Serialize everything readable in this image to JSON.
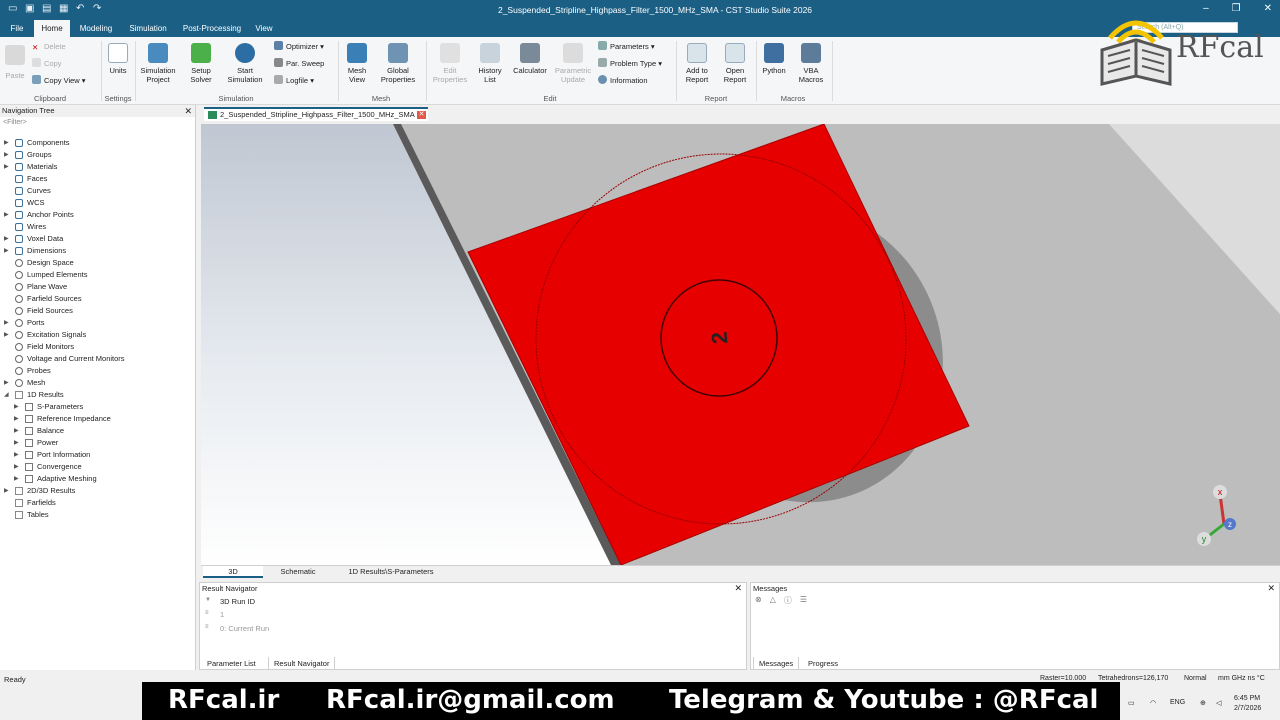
{
  "window": {
    "title": "2_Suspended_Stripline_Highpass_Filter_1500_MHz_SMA - CST Studio Suite 2026",
    "search_placeholder": "Search (Alt+Q)"
  },
  "menu": {
    "tabs": [
      "File",
      "Home",
      "Modeling",
      "Simulation",
      "Post-Processing",
      "View"
    ],
    "active": "Home"
  },
  "ribbon": {
    "clipboard": {
      "paste": "Paste",
      "delete": "Delete",
      "copy": "Copy",
      "copy_view": "Copy View",
      "group": "Clipboard"
    },
    "settings": {
      "units": "Units",
      "group": "Settings"
    },
    "simulation": {
      "sim_project": "Simulation Project",
      "setup_solver": "Setup Solver",
      "start_sim": "Start Simulation",
      "optimizer": "Optimizer",
      "par_sweep": "Par. Sweep",
      "logfile": "Logfile",
      "group": "Simulation"
    },
    "mesh": {
      "mesh_view": "Mesh View",
      "global_props": "Global Properties",
      "group": "Mesh"
    },
    "edit": {
      "edit_props": "Edit Properties",
      "history": "History List",
      "calculator": "Calculator",
      "param_update": "Parametric Update",
      "parameters": "Parameters",
      "problem_type": "Problem Type",
      "information": "Information",
      "group": "Edit"
    },
    "report": {
      "add": "Add to Report",
      "open": "Open Report",
      "group": "Report"
    },
    "macros": {
      "python": "Python",
      "vba": "VBA Macros",
      "group": "Macros"
    }
  },
  "nav": {
    "title": "Navigation Tree",
    "filter": "<Filter>",
    "items": [
      {
        "label": "Components",
        "level": 0,
        "icon": "component-icon",
        "expand": "closed"
      },
      {
        "label": "Groups",
        "level": 0,
        "icon": "component-icon",
        "expand": "closed"
      },
      {
        "label": "Materials",
        "level": 0,
        "icon": "component-icon",
        "expand": "closed"
      },
      {
        "label": "Faces",
        "level": 0,
        "icon": "component-icon",
        "expand": "none"
      },
      {
        "label": "Curves",
        "level": 0,
        "icon": "component-icon",
        "expand": "none"
      },
      {
        "label": "WCS",
        "level": 0,
        "icon": "component-icon",
        "expand": "none"
      },
      {
        "label": "Anchor Points",
        "level": 0,
        "icon": "component-icon",
        "expand": "closed"
      },
      {
        "label": "Wires",
        "level": 0,
        "icon": "component-icon",
        "expand": "none"
      },
      {
        "label": "Voxel Data",
        "level": 0,
        "icon": "component-icon",
        "expand": "closed"
      },
      {
        "label": "Dimensions",
        "level": 0,
        "icon": "component-icon",
        "expand": "closed"
      },
      {
        "label": "Design Space",
        "level": 0,
        "icon": "gear-icon",
        "expand": "none"
      },
      {
        "label": "Lumped Elements",
        "level": 0,
        "icon": "gear-icon",
        "expand": "none"
      },
      {
        "label": "Plane Wave",
        "level": 0,
        "icon": "gear-icon",
        "expand": "none"
      },
      {
        "label": "Farfield Sources",
        "level": 0,
        "icon": "gear-icon",
        "expand": "none"
      },
      {
        "label": "Field Sources",
        "level": 0,
        "icon": "gear-icon",
        "expand": "none"
      },
      {
        "label": "Ports",
        "level": 0,
        "icon": "gear-icon",
        "expand": "closed"
      },
      {
        "label": "Excitation Signals",
        "level": 0,
        "icon": "gear-icon",
        "expand": "closed"
      },
      {
        "label": "Field Monitors",
        "level": 0,
        "icon": "gear-icon",
        "expand": "none"
      },
      {
        "label": "Voltage and Current Monitors",
        "level": 0,
        "icon": "gear-icon",
        "expand": "none"
      },
      {
        "label": "Probes",
        "level": 0,
        "icon": "gear-icon",
        "expand": "none"
      },
      {
        "label": "Mesh",
        "level": 0,
        "icon": "gear-icon",
        "expand": "closed"
      },
      {
        "label": "1D Results",
        "level": 0,
        "icon": "result-icon",
        "expand": "open"
      },
      {
        "label": "S-Parameters",
        "level": 1,
        "icon": "folder-icon",
        "expand": "closed"
      },
      {
        "label": "Reference Impedance",
        "level": 1,
        "icon": "folder-icon",
        "expand": "closed"
      },
      {
        "label": "Balance",
        "level": 1,
        "icon": "folder-icon",
        "expand": "closed"
      },
      {
        "label": "Power",
        "level": 1,
        "icon": "folder-icon",
        "expand": "closed"
      },
      {
        "label": "Port Information",
        "level": 1,
        "icon": "folder-icon",
        "expand": "closed"
      },
      {
        "label": "Convergence",
        "level": 1,
        "icon": "folder-icon",
        "expand": "closed"
      },
      {
        "label": "Adaptive Meshing",
        "level": 1,
        "icon": "folder-icon",
        "expand": "closed"
      },
      {
        "label": "2D/3D Results",
        "level": 0,
        "icon": "result-icon",
        "expand": "closed"
      },
      {
        "label": "Farfields",
        "level": 0,
        "icon": "result-icon",
        "expand": "none"
      },
      {
        "label": "Tables",
        "level": 0,
        "icon": "result-icon",
        "expand": "none"
      }
    ]
  },
  "doc_tab": "2_Suspended_Stripline_Highpass_Filter_1500_MHz_SMA",
  "view_tabs": [
    "3D",
    "Schematic",
    "1D Results\\S-Parameters"
  ],
  "view_active": "3D",
  "viewport": {
    "port_label": "2",
    "axis": {
      "x": "x",
      "y": "y",
      "z": "z"
    }
  },
  "result_navigator": {
    "title": "Result Navigator",
    "header": "3D Run ID",
    "rows": [
      "1",
      "0: Current Run"
    ],
    "tabs": [
      "Parameter List",
      "Result Navigator"
    ],
    "active_tab": "Result Navigator"
  },
  "messages": {
    "title": "Messages",
    "tabs": [
      "Messages",
      "Progress"
    ],
    "active_tab": "Messages"
  },
  "status": {
    "left": "Ready",
    "raster": "Raster=10.000",
    "tets": "Tetrahedrons=126,170",
    "mode": "Normal",
    "units": "mm  GHz  ns  °C"
  },
  "banner": {
    "site": "RFcal.ir",
    "email": "RFcal.ir@gmail.com",
    "social": "Telegram & Youtube : @RFcal"
  },
  "logo": {
    "text": "RFcal"
  },
  "tray": {
    "lang": "ENG",
    "time": "6:45 PM",
    "date": "2/7/2026"
  },
  "colors": {
    "brand": "#1b5f85",
    "part": "#e60000"
  }
}
